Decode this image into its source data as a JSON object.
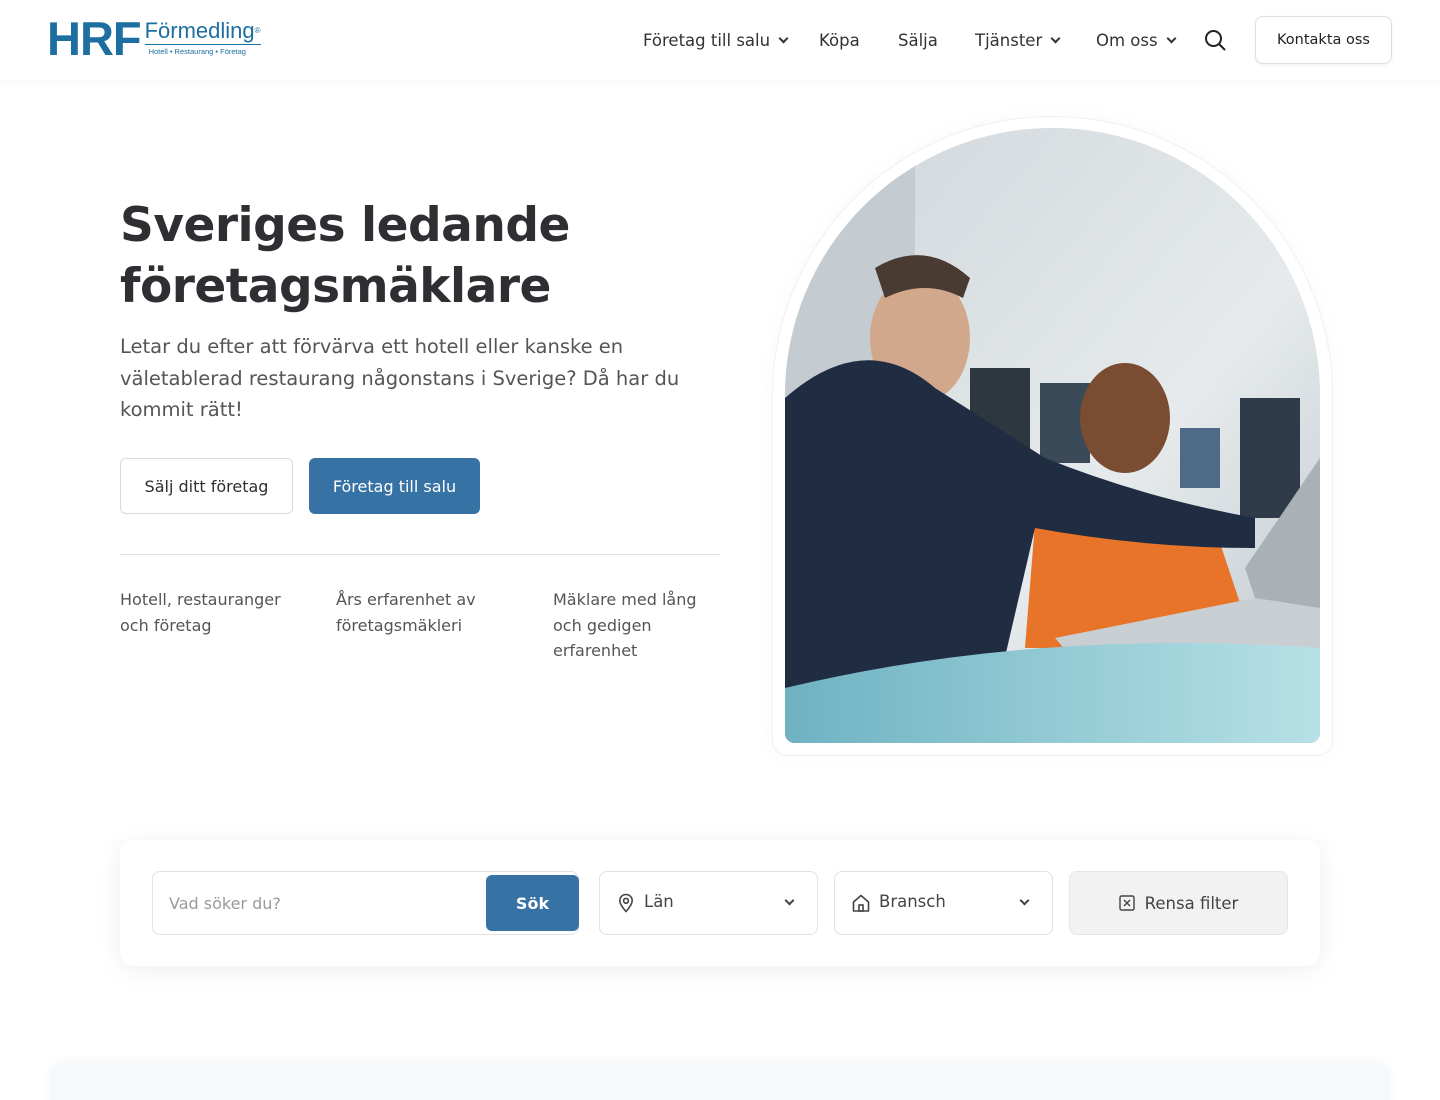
{
  "brand": {
    "logo_main": "HRF",
    "logo_name": "Förmedling",
    "logo_mark": "®",
    "logo_tagline": "Hotell • Restaurang • Företag"
  },
  "nav": {
    "items": [
      {
        "label": "Företag till salu",
        "dropdown": true
      },
      {
        "label": "Köpa",
        "dropdown": false
      },
      {
        "label": "Sälja",
        "dropdown": false
      },
      {
        "label": "Tjänster",
        "dropdown": true
      },
      {
        "label": "Om oss",
        "dropdown": true
      }
    ],
    "search_icon": "search-icon",
    "contact_label": "Kontakta oss"
  },
  "hero": {
    "title": "Sveriges ledande företagsmäklare",
    "text": "Letar du efter att förvärva ett hotell eller kanske en väletablerad restaurang någonstans i Sverige? Då har du kommit rätt!",
    "btn_sell": "Sälj ditt företag",
    "btn_forsale": "Företag till salu",
    "stats": [
      "Hotell, restauranger och företag",
      "Års erfarenhet av företagsmäkleri",
      "Mäklare med lång och gedigen erfarenhet"
    ]
  },
  "search": {
    "placeholder": "Vad söker du?",
    "submit": "Sök",
    "region": {
      "label": "Län",
      "icon": "location-pin-icon"
    },
    "industry": {
      "label": "Bransch",
      "icon": "home-icon"
    },
    "clear": {
      "label": "Rensa filter",
      "icon": "clear-x-icon"
    }
  },
  "colors": {
    "brand": "#1d6fa1",
    "primary_button": "#3772a4",
    "text": "#2f2f33"
  }
}
